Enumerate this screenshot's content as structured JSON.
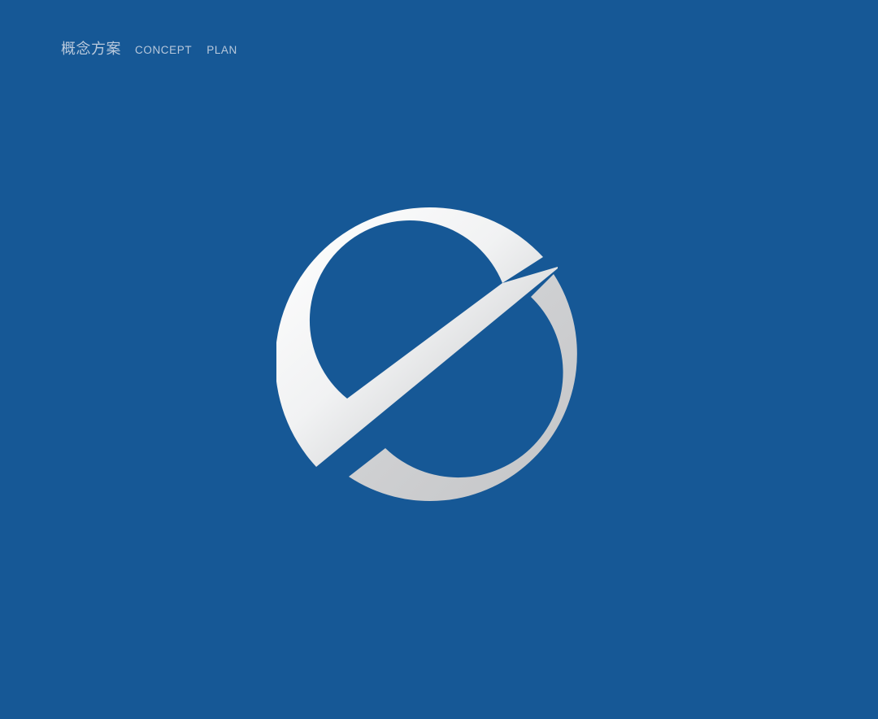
{
  "header": {
    "title_cn": "概念方案",
    "title_en_1": "CONCEPT",
    "title_en_2": "PLAN"
  },
  "colors": {
    "background": "#165896",
    "text": "#b9c9dc",
    "logo_light": "#ffffff",
    "logo_dark": "#c2c2c4"
  },
  "logo": {
    "icon": "circle-slash-logo-icon"
  }
}
